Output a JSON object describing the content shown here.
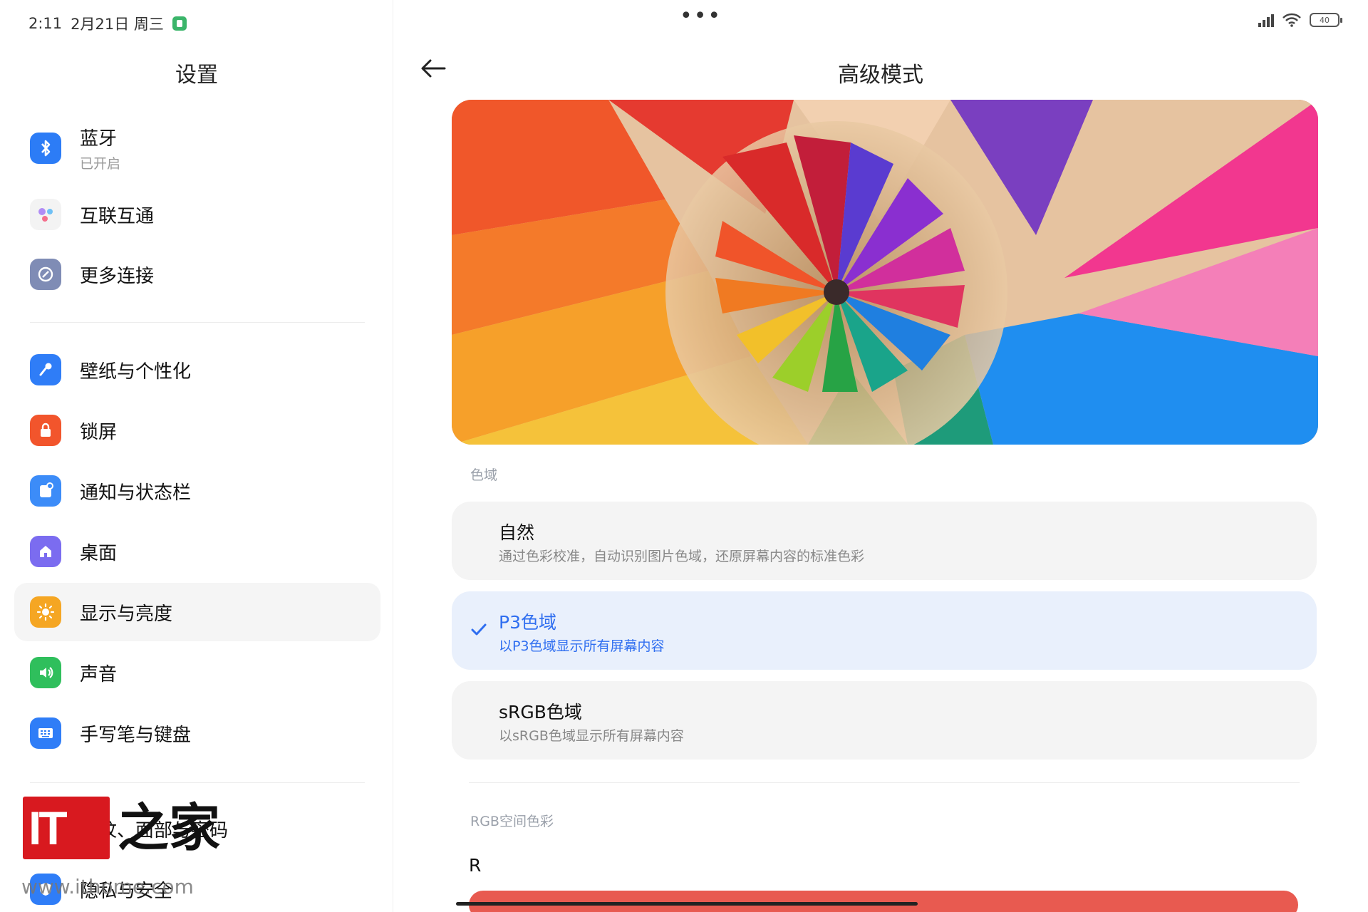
{
  "status": {
    "time": "2:11",
    "date": "2月21日 周三",
    "battery": "40"
  },
  "sidebar": {
    "title": "设置",
    "items": [
      {
        "label": "蓝牙",
        "sub": "已开启",
        "icon": "bluetooth-icon",
        "color": "#2c7cf6"
      },
      {
        "label": "互联互通",
        "icon": "interconnect-icon",
        "color": "#f3f3f3"
      },
      {
        "label": "更多连接",
        "icon": "link-icon",
        "color": "#7f8cb5"
      },
      {
        "label": "壁纸与个性化",
        "icon": "brush-icon",
        "color": "#2f7df7"
      },
      {
        "label": "锁屏",
        "icon": "lock-icon",
        "color": "#f2552c"
      },
      {
        "label": "通知与状态栏",
        "icon": "notification-icon",
        "color": "#3c8cf8"
      },
      {
        "label": "桌面",
        "icon": "home-icon",
        "color": "#7b6cf0"
      },
      {
        "label": "显示与亮度",
        "icon": "sun-icon",
        "color": "#f5a623"
      },
      {
        "label": "声音",
        "icon": "speaker-icon",
        "color": "#2fbf5c"
      },
      {
        "label": "手写笔与键盘",
        "icon": "keyboard-icon",
        "color": "#2f7df7"
      },
      {
        "label": "指纹、面部与密码",
        "icon": "fingerprint-icon",
        "color": "#2f7df7"
      },
      {
        "label": "隐私与安全",
        "icon": "shield-icon",
        "color": "#2f7df7"
      }
    ],
    "active_index": 7
  },
  "watermark": {
    "logo_text": "IT",
    "char": "之家",
    "url": "www.ithome.com"
  },
  "main": {
    "title": "高级模式",
    "section_gamut": "色域",
    "options": [
      {
        "title": "自然",
        "desc": "通过色彩校准，自动识别图片色域，还原屏幕内容的标准色彩",
        "selected": false
      },
      {
        "title": "P3色域",
        "desc": "以P3色域显示所有屏幕内容",
        "selected": true
      },
      {
        "title": "sRGB色域",
        "desc": "以sRGB色域显示所有屏幕内容",
        "selected": false
      }
    ],
    "section_rgb": "RGB空间色彩",
    "r_label": "R"
  },
  "colors": {
    "accent": "#2f6ef0",
    "selected_bg": "#e9f0fc",
    "slider_red": "#e85a50"
  }
}
